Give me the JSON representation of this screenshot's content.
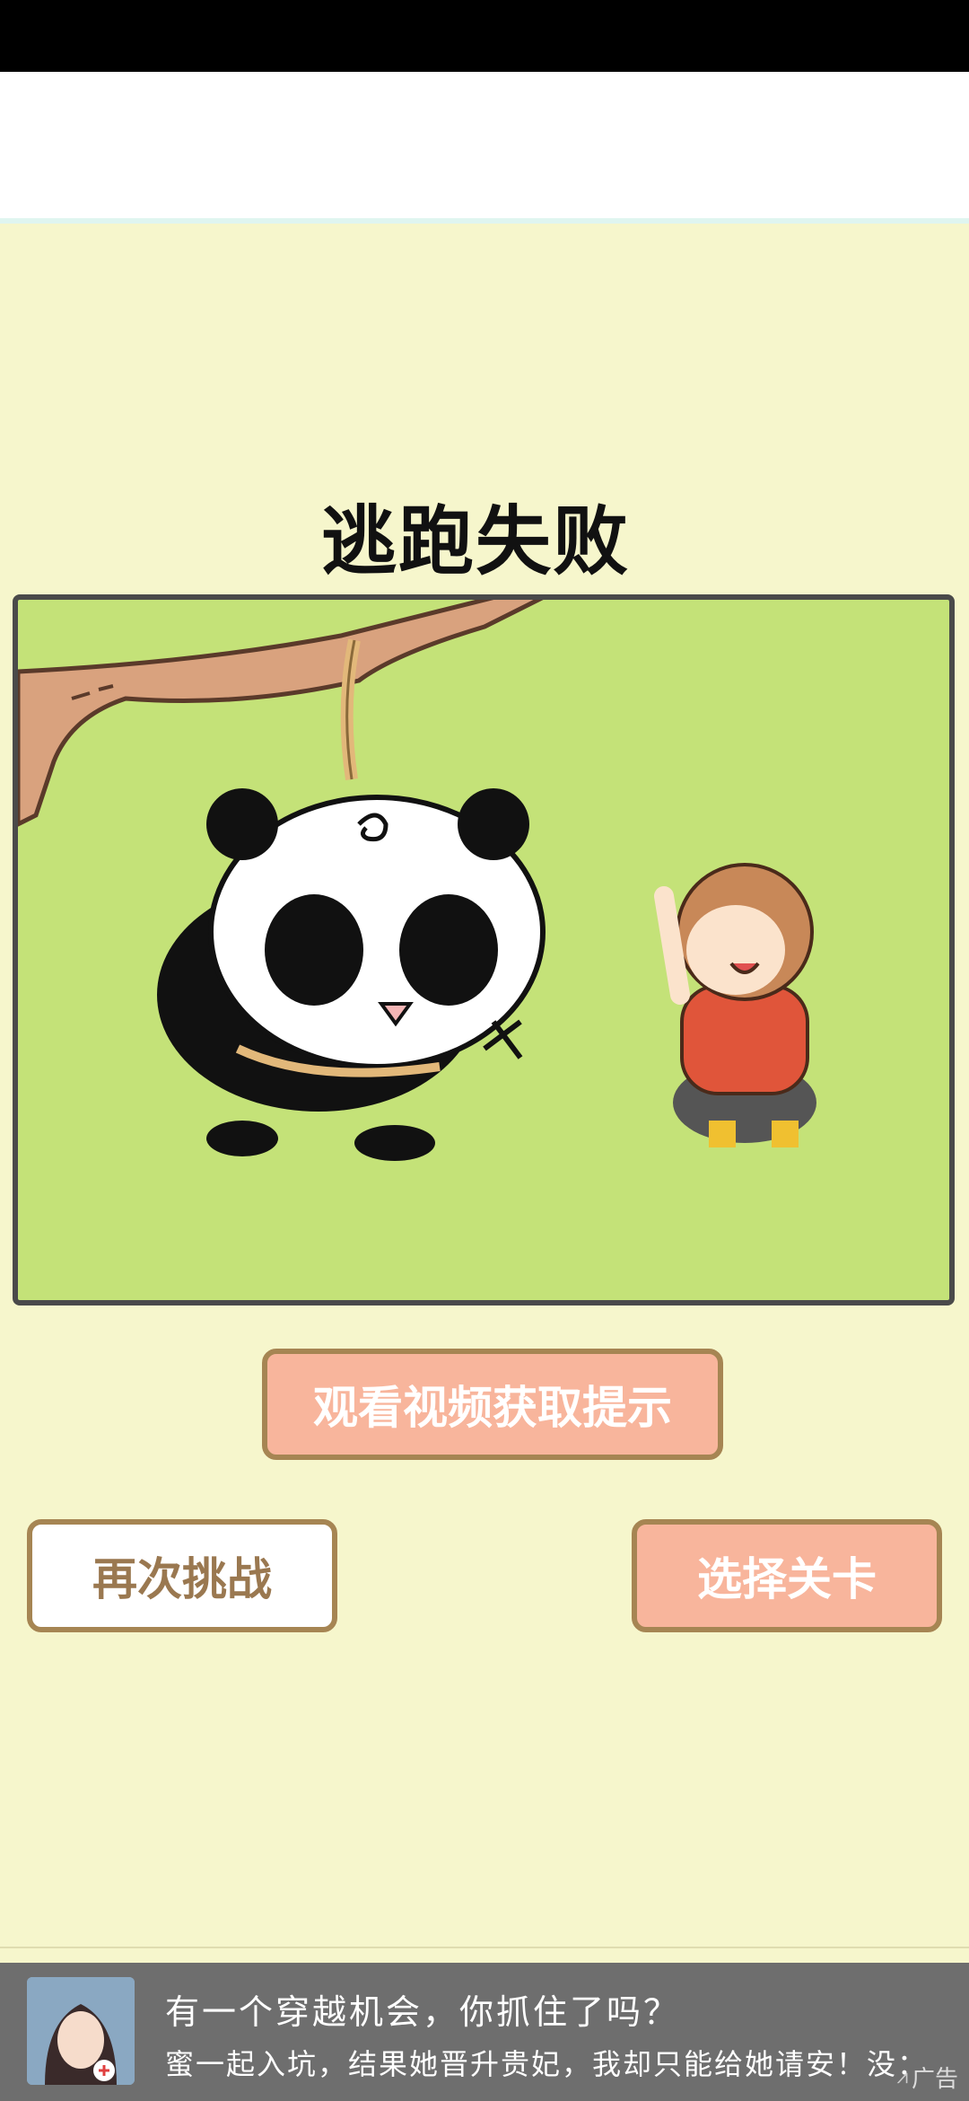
{
  "result": {
    "title": "逃跑失败"
  },
  "buttons": {
    "hint": "观看视频获取提示",
    "retry": "再次挑战",
    "select_level": "选择关卡"
  },
  "ad": {
    "title": "有一个穿越机会，你抓住了吗？",
    "description": "蜜一起入坑，结果她晋升贵妃，我却只能给她请安！没：",
    "tag": "广告"
  },
  "colors": {
    "background": "#f6f6cc",
    "scene_green": "#c4e278",
    "button_peach": "#f8b59c",
    "button_border": "#a68553",
    "button_text_brown": "#9a7850"
  }
}
